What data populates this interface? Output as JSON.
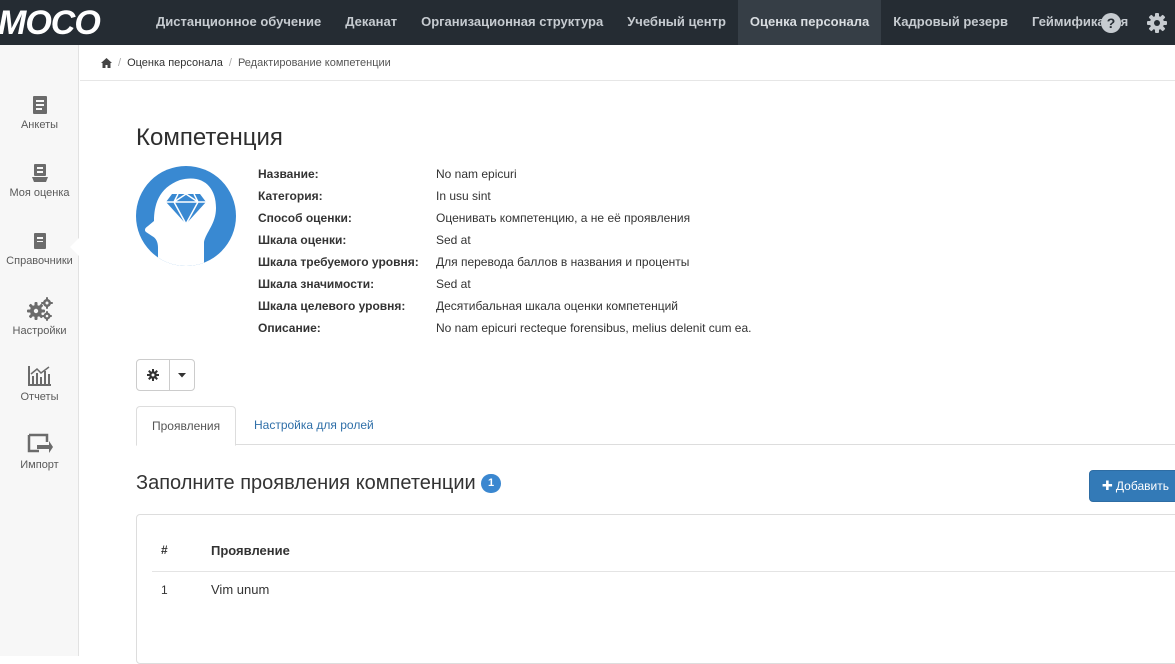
{
  "brand": {
    "logo_text": "MOCO",
    "nav_color": "#252c33",
    "accent": "#3989d2"
  },
  "topnav": {
    "items": [
      {
        "label": "Дистанционное обучение"
      },
      {
        "label": "Деканат"
      },
      {
        "label": "Организационная структура"
      },
      {
        "label": "Учебный центр"
      },
      {
        "label": "Оценка персонала",
        "active": true
      },
      {
        "label": "Кадровый резерв"
      },
      {
        "label": "Геймификация"
      }
    ],
    "icons": [
      "help-icon",
      "settings-gear-icon"
    ]
  },
  "sidebar": {
    "items": [
      {
        "label": "Анкеты",
        "icon": "questionnaire-icon"
      },
      {
        "label": "Моя оценка",
        "icon": "my-assessment-icon"
      },
      {
        "label": "Справочники",
        "icon": "reference-book-icon",
        "active": true
      },
      {
        "label": "Настройки",
        "icon": "gears-icon"
      },
      {
        "label": "Отчеты",
        "icon": "chart-icon"
      },
      {
        "label": "Импорт",
        "icon": "import-icon"
      }
    ]
  },
  "breadcrumb": {
    "home_icon": "home-icon",
    "items": [
      "Оценка персонала",
      "Редактирование компетенции"
    ]
  },
  "competence": {
    "title": "Компетенция",
    "avatar_icon": "head-diamond-icon",
    "properties": [
      {
        "key": "Название:",
        "value": "No nam epicuri"
      },
      {
        "key": "Категория:",
        "value": "In usu sint"
      },
      {
        "key": "Способ оценки:",
        "value": "Оценивать компетенцию, а не её проявления"
      },
      {
        "key": "Шкала оценки:",
        "value": "Sed at"
      },
      {
        "key": "Шкала требуемого уровня:",
        "value": "Для перевода баллов в названия и проценты"
      },
      {
        "key": "Шкала значимости:",
        "value": "Sed at"
      },
      {
        "key": "Шкала целевого уровня:",
        "value": "Десятибальная шкала оценки компетенций"
      },
      {
        "key": "Описание:",
        "value": "No nam epicuri recteque forensibus, melius delenit cum ea."
      }
    ]
  },
  "tabs": [
    {
      "label": "Проявления",
      "active": true
    },
    {
      "label": "Настройка для ролей"
    }
  ],
  "manifestations": {
    "title": "Заполните проявления компетенции",
    "count": "1",
    "add_label": "Добавить",
    "columns": [
      "#",
      "Проявление"
    ],
    "rows": [
      {
        "num": "1",
        "name": "Vim unum"
      }
    ]
  }
}
